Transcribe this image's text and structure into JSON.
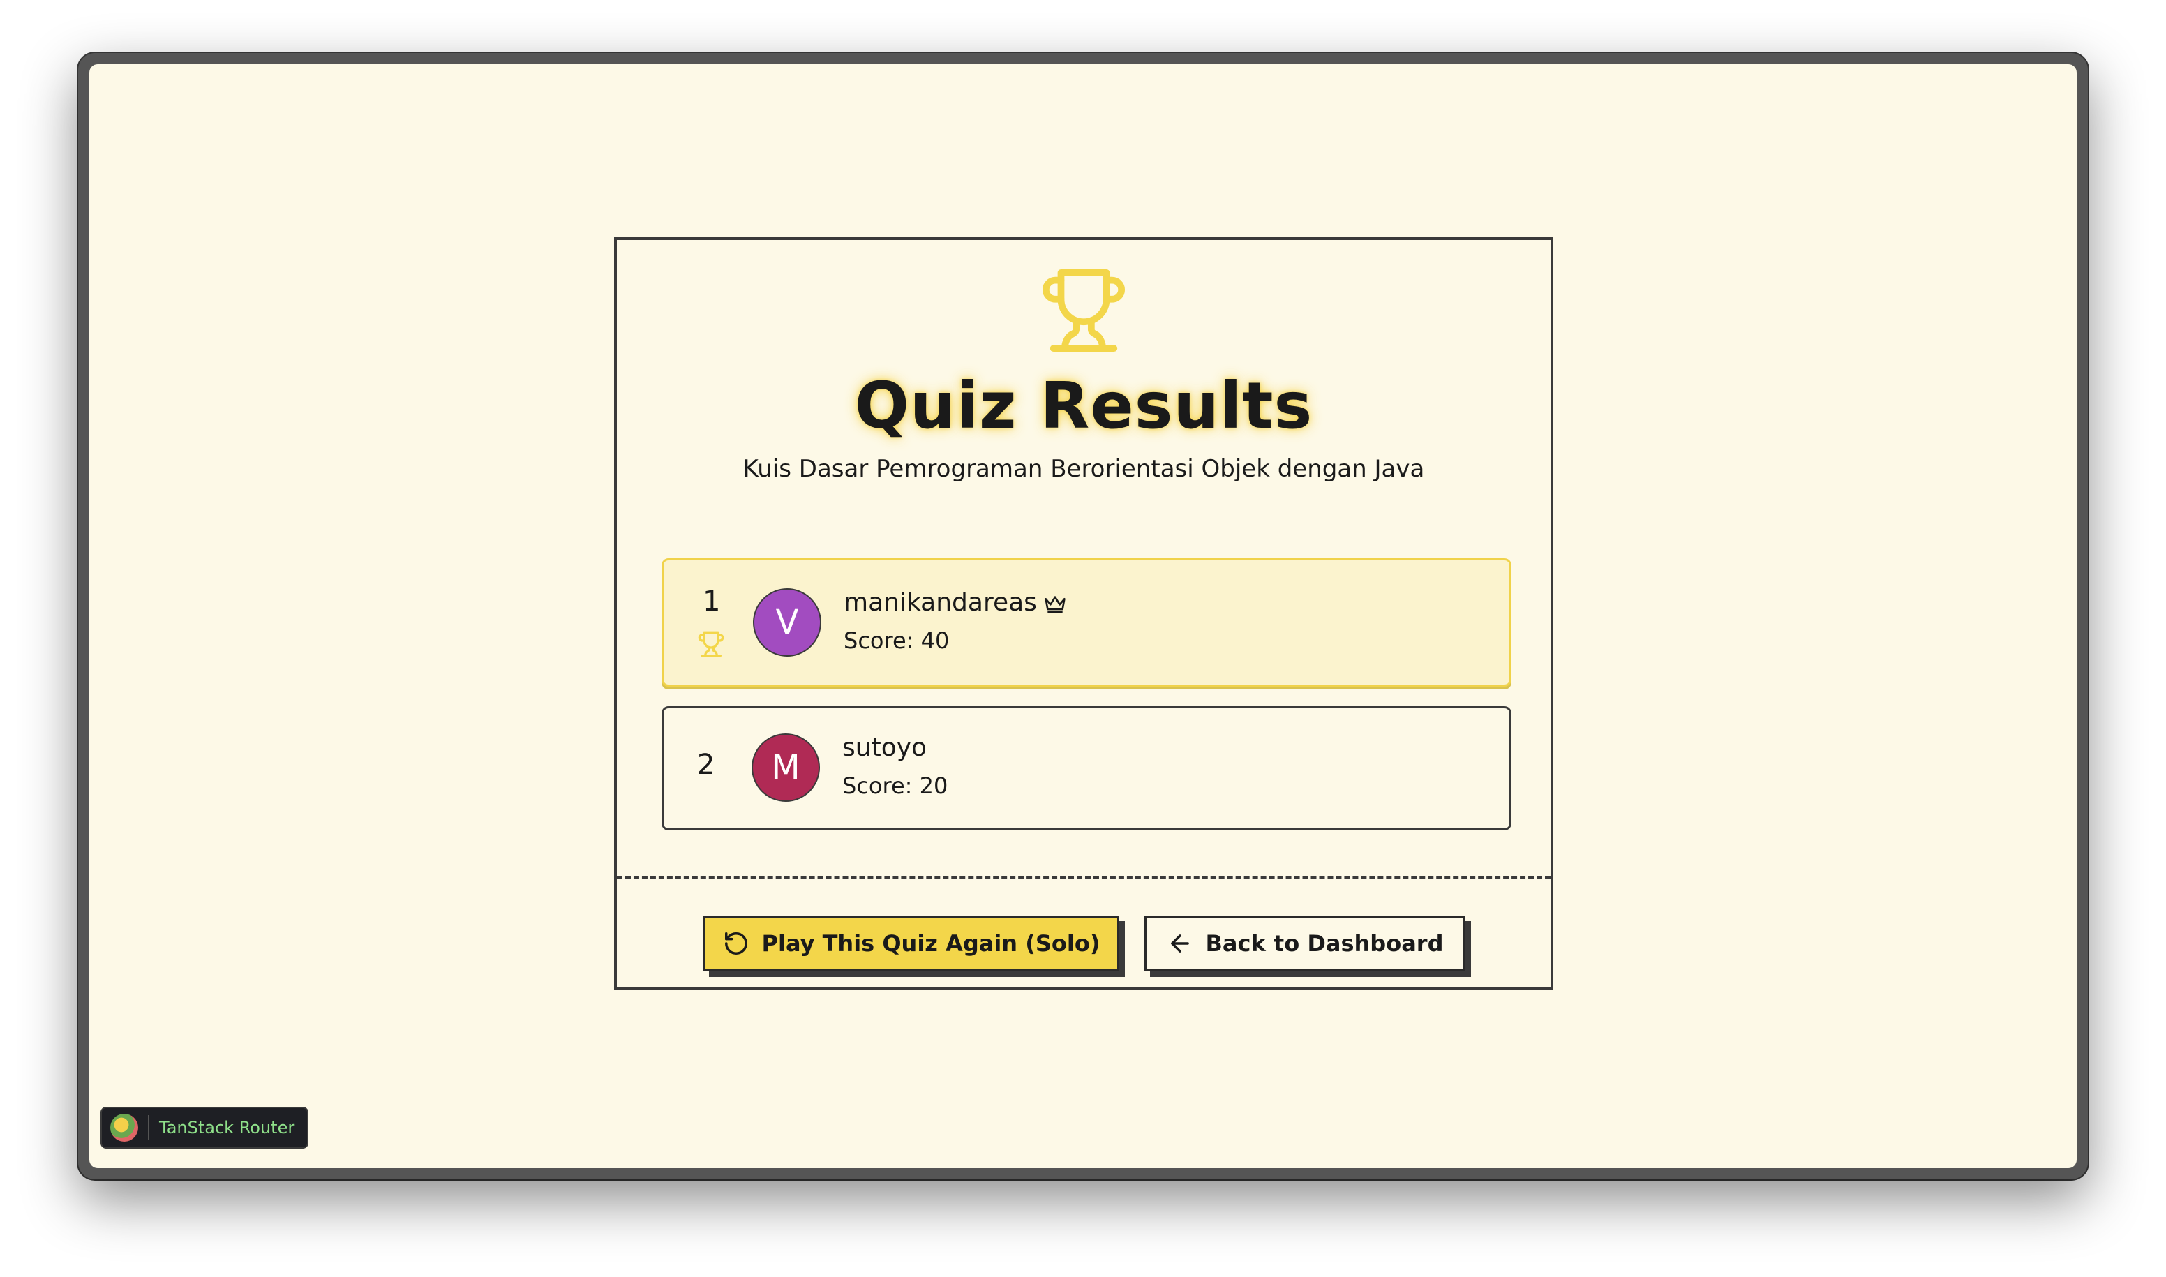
{
  "results": {
    "title": "Quiz Results",
    "subtitle": "Kuis Dasar Pemrograman Berorientasi Objek dengan Java",
    "accent_color": "#f3d64a",
    "players": [
      {
        "rank": "1",
        "initial": "V",
        "name": "manikandareas",
        "score": "Score: 40",
        "avatar_color": "#a24cc0",
        "icons": [
          "trophy-icon",
          "crown-icon"
        ]
      },
      {
        "rank": "2",
        "initial": "M",
        "name": "sutoyo",
        "score": "Score: 20",
        "avatar_color": "#b02a55"
      }
    ]
  },
  "actions": {
    "play_again_label": "Play This Quiz Again (Solo)",
    "back_label": "Back to Dashboard"
  },
  "devtools": {
    "label": "TanStack Router"
  }
}
